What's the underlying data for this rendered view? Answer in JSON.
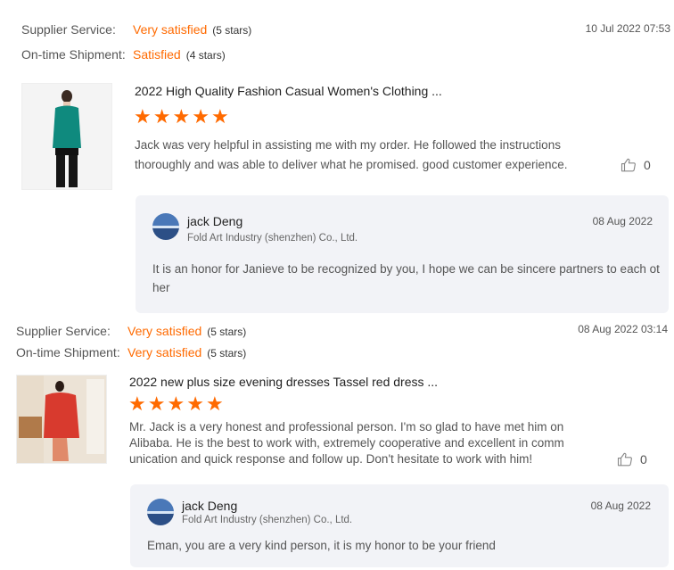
{
  "reviews": [
    {
      "supplier_service_label": "Supplier Service:",
      "supplier_service_rating": "Very satisfied",
      "supplier_service_stars": "(5 stars)",
      "shipment_label": "On-time Shipment:",
      "shipment_rating": "Satisfied",
      "shipment_stars": "(4 stars)",
      "date": "10 Jul 2022 07:53",
      "product_title": "2022 High Quality Fashion Casual Women's Clothing ...",
      "star_count": 5,
      "comment": "Jack was very helpful in assisting me with my order. He followed the instructions thoroughly and was able to deliver what he promised. good customer experience.",
      "likes": "0",
      "reply": {
        "name": "jack Deng",
        "company": "Fold Art Industry (shenzhen) Co., Ltd.",
        "date": "08 Aug 2022",
        "text": "It is an honor for Janieve to be recognized by you, I hope we can be sincere partners to each ot her"
      }
    },
    {
      "supplier_service_label": "Supplier Service:",
      "supplier_service_rating": "Very satisfied",
      "supplier_service_stars": "(5 stars)",
      "shipment_label": "On-time Shipment:",
      "shipment_rating": "Very satisfied",
      "shipment_stars": "(5 stars)",
      "date": "08 Aug 2022 03:14",
      "product_title": "2022 new plus size evening dresses Tassel red dress ...",
      "star_count": 5,
      "comment": "Mr. Jack is a very honest and professional person. I'm so glad to have met him on Alibaba. He is the best to work with, extremely cooperative and excellent in comm unication and quick response and follow up. Don't hesitate to work with him!",
      "likes": "0",
      "reply": {
        "name": "jack Deng",
        "company": "Fold Art Industry (shenzhen) Co., Ltd.",
        "date": "08 Aug 2022",
        "text": "Eman, you are a very kind person, it is my honor to be your friend"
      }
    }
  ],
  "icons": {
    "star": "star-icon",
    "like": "thumbs-up-icon"
  },
  "colors": {
    "accent": "#ff6a00",
    "reply_bg": "#f2f3f7"
  }
}
